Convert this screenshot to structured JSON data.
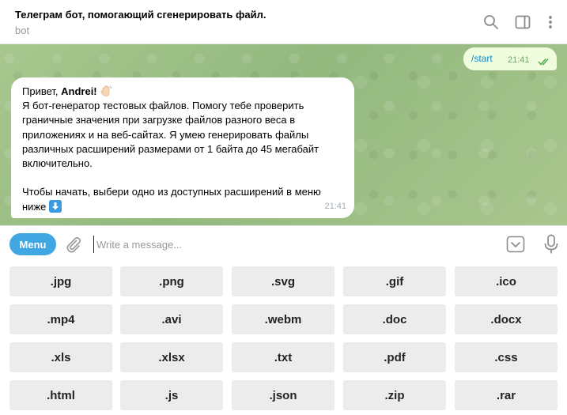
{
  "header": {
    "title": "Телеграм бот, помогающий сгенерировать файл.",
    "subtitle": "bot",
    "icons": [
      "search-icon",
      "sidebar-toggle-icon",
      "more-vert-icon"
    ]
  },
  "chat": {
    "outgoing": {
      "text": "/start",
      "time": "21:41",
      "status": "read"
    },
    "incoming": {
      "greeting_prefix": "Привет, ",
      "greeting_name": "Andrei!",
      "greeting_emoji": "waving-hand-icon",
      "lines": [
        "Я бот-генератор тестовых файлов. Помогу тебе проверить",
        "граничные значения при загрузке файлов разного веса в",
        "приложениях и на веб-сайтах. Я умею генерировать файлы",
        "различных расширений размерами от 1 байта до 45 мегабайт",
        "включительно."
      ],
      "start_line_1": "Чтобы начать, выбери одно из доступных расширений в меню",
      "start_line_2": "ниже",
      "start_emoji": "down-arrow-icon",
      "time": "21:41"
    }
  },
  "input": {
    "menu_label": "Menu",
    "placeholder": "Write a message...",
    "value": ""
  },
  "keyboard": {
    "rows": [
      [
        ".jpg",
        ".png",
        ".svg",
        ".gif",
        ".ico"
      ],
      [
        ".mp4",
        ".avi",
        ".webm",
        ".doc",
        ".docx"
      ],
      [
        ".xls",
        ".xlsx",
        ".txt",
        ".pdf",
        ".css"
      ],
      [
        ".html",
        ".js",
        ".json",
        ".zip",
        ".rar"
      ]
    ]
  },
  "colors": {
    "accent": "#40a7e3",
    "outgoing_bubble": "#effdde",
    "check_color": "#4fae4e",
    "key_bg": "#ececec"
  }
}
